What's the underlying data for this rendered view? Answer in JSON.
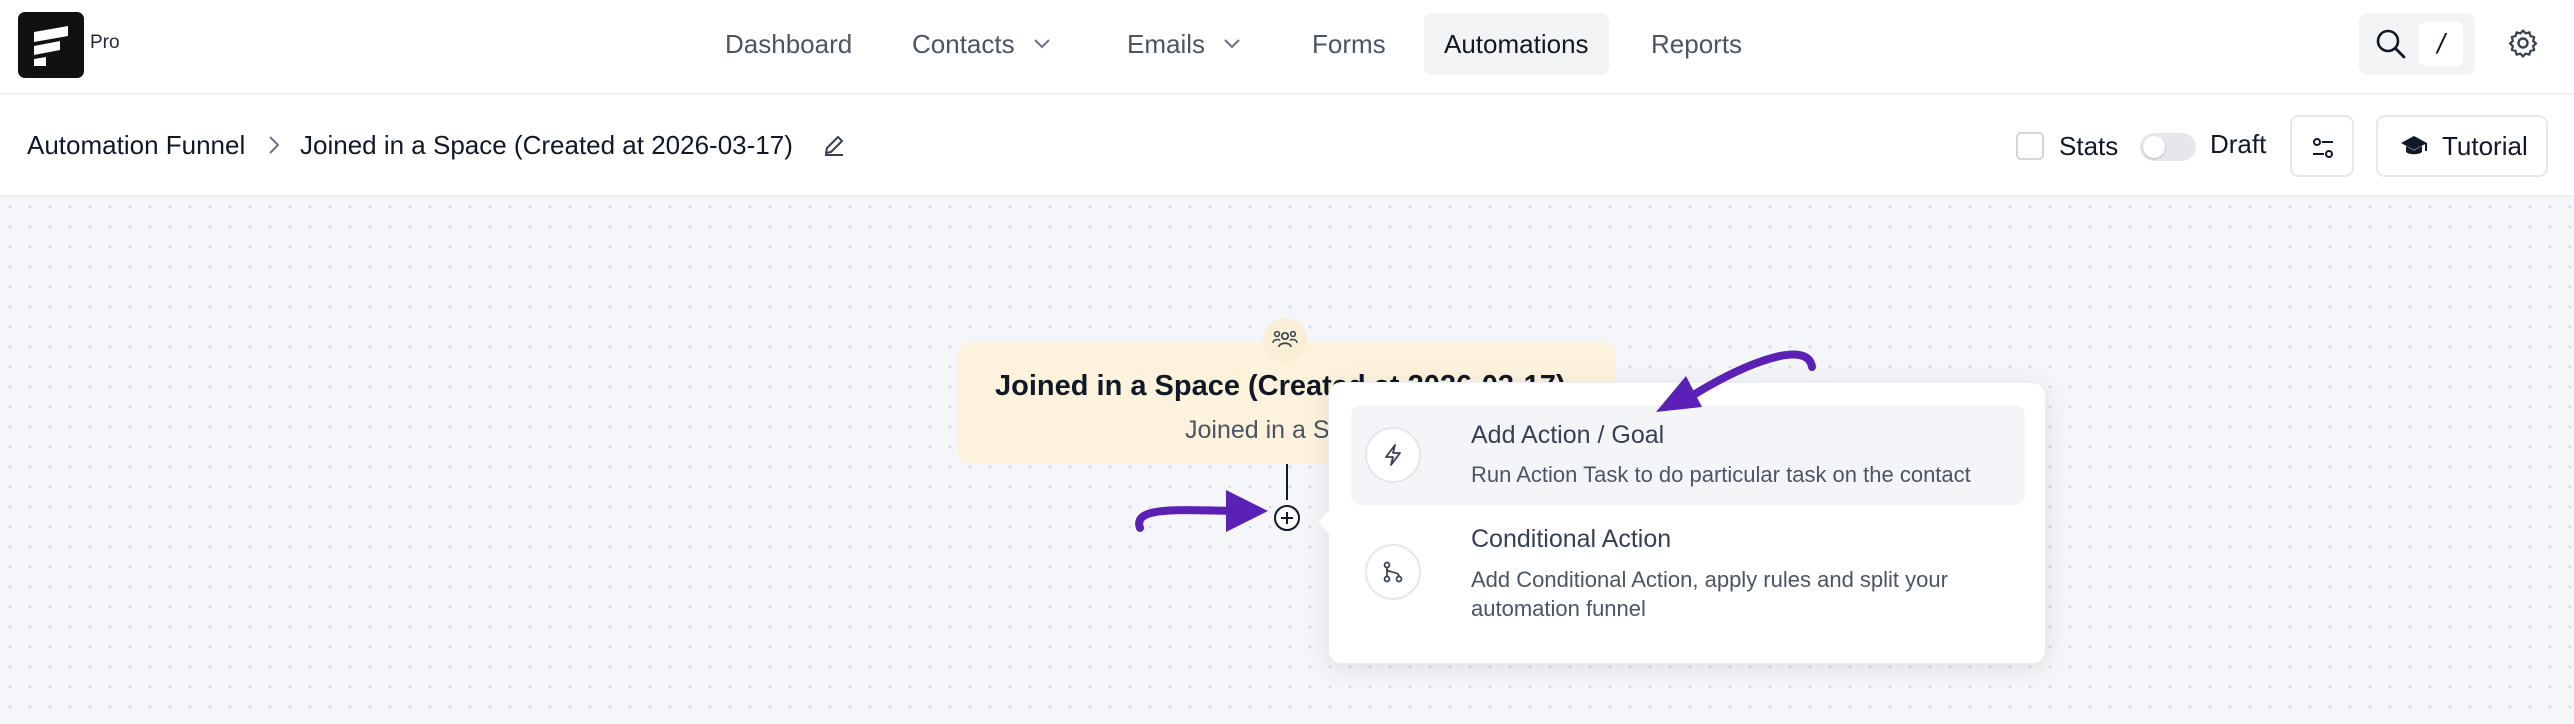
{
  "brand": {
    "badge": "Pro",
    "logo_icon": "fluentcrm-logo"
  },
  "nav": {
    "items": [
      {
        "label": "Dashboard",
        "has_dropdown": false,
        "active": false
      },
      {
        "label": "Contacts",
        "has_dropdown": true,
        "active": false
      },
      {
        "label": "Emails",
        "has_dropdown": true,
        "active": false
      },
      {
        "label": "Forms",
        "has_dropdown": false,
        "active": false
      },
      {
        "label": "Automations",
        "has_dropdown": false,
        "active": true
      },
      {
        "label": "Reports",
        "has_dropdown": false,
        "active": false
      }
    ],
    "search_shortcut": "/",
    "search_icon": "search-icon",
    "settings_icon": "gear-icon"
  },
  "breadcrumb": {
    "root": "Automation Funnel",
    "current": "Joined in a Space (Created at 2026-03-17)"
  },
  "header_controls": {
    "stats_label": "Stats",
    "stats_checked": false,
    "draft_label": "Draft",
    "draft_on": false,
    "tutorial_label": "Tutorial"
  },
  "trigger": {
    "title": "Joined in a Space (Created at 2026-03-17)",
    "subtitle": "Joined in a Space",
    "icon": "users-icon"
  },
  "popover": {
    "items": [
      {
        "title": "Add Action / Goal",
        "description": "Run Action Task to do particular task on the contact",
        "icon": "bolt-icon",
        "highlighted": true
      },
      {
        "title": "Conditional Action",
        "description": "Add Conditional Action, apply rules and split your automation funnel",
        "icon": "branch-icon",
        "highlighted": false
      }
    ]
  },
  "colors": {
    "accent_arrow": "#5b21b6",
    "trigger_bg": "#fdf3dd",
    "canvas_bg": "#f5f6fa",
    "active_tab_bg": "#f3f4f6"
  }
}
